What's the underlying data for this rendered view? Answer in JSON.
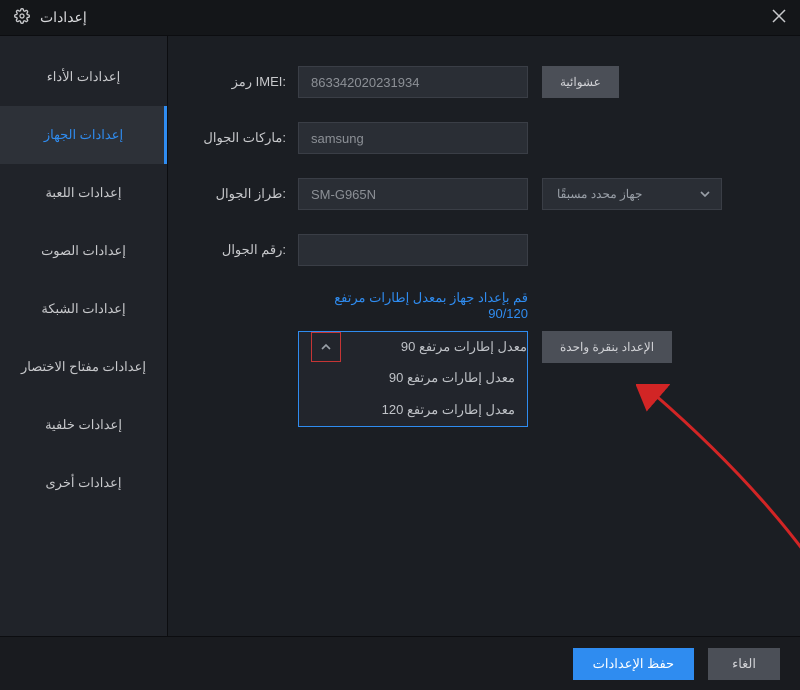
{
  "window": {
    "title": "إعدادات"
  },
  "sidebar": {
    "items": [
      {
        "label": "إعدادات الأداء"
      },
      {
        "label": "إعدادات الجهاز"
      },
      {
        "label": "إعدادات اللعبة"
      },
      {
        "label": "إعدادات الصوت"
      },
      {
        "label": "إعدادات الشبكة"
      },
      {
        "label": "إعدادات مفتاح الاختصار"
      },
      {
        "label": "إعدادات خلفية"
      },
      {
        "label": "إعدادات أخرى"
      }
    ],
    "active_index": 1
  },
  "form": {
    "imei": {
      "label": "رمز IMEI:",
      "value": "863342020231934",
      "random_btn": "عشوائية"
    },
    "brand": {
      "label": "ماركات الجوال:",
      "value": "samsung"
    },
    "model": {
      "label": "طراز الجوال:",
      "value": "SM-G965N",
      "preset_label": "جهاز محدد مسبقًا"
    },
    "number": {
      "label": "رقم الجوال:",
      "value": ""
    }
  },
  "frame": {
    "heading": "قم بإعداد جهاز بمعدل إطارات مرتفع 90/120",
    "selected": "معدل إطارات مرتفع 90",
    "options": [
      "معدل إطارات مرتفع 90",
      "معدل إطارات مرتفع 120"
    ],
    "one_click_btn": "الإعداد بنقرة واحدة"
  },
  "footer": {
    "save": "حفظ الإعدادات",
    "cancel": "الغاء"
  },
  "colors": {
    "accent": "#2f8cf0",
    "highlight_border": "#c53535"
  }
}
